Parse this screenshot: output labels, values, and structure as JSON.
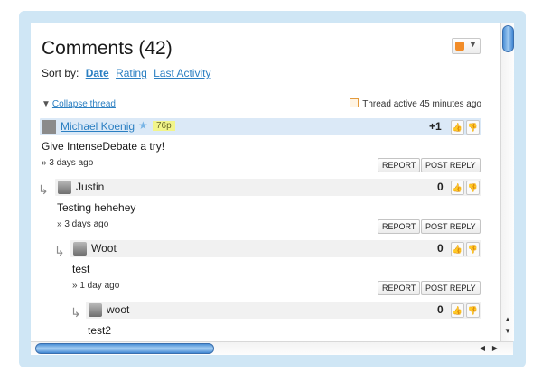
{
  "header": {
    "title": "Comments (42)"
  },
  "sort": {
    "label": "Sort by:",
    "options": [
      "Date",
      "Rating",
      "Last Activity"
    ]
  },
  "thread": {
    "collapse_label": "Collapse thread",
    "active_label": "Thread active 45 minutes ago"
  },
  "comments": [
    {
      "author": "Michael Koenig",
      "badge": "76p",
      "score": "+1",
      "text": "Give IntenseDebate a try!",
      "time": "» 3 days ago",
      "report": "REPORT",
      "reply": "POST REPLY"
    },
    {
      "author": "Justin",
      "score": "0",
      "text": "Testing hehehey",
      "time": "» 3 days ago",
      "report": "REPORT",
      "reply": "POST REPLY"
    },
    {
      "author": "Woot",
      "score": "0",
      "text": "test",
      "time": "» 1 day ago",
      "report": "REPORT",
      "reply": "POST REPLY"
    },
    {
      "author": "woot",
      "score": "0",
      "text": "test2"
    }
  ],
  "icons": {
    "rss": "rss-icon",
    "thumb_up": "thumb-up-icon",
    "thumb_down": "thumb-down-icon",
    "reply": "reply-arrow-icon",
    "avatar": "avatar-icon"
  },
  "colors": {
    "accent": "#2b7fc2",
    "frame": "#cfe6f5",
    "highlight_bar": "#dbe9f7"
  }
}
